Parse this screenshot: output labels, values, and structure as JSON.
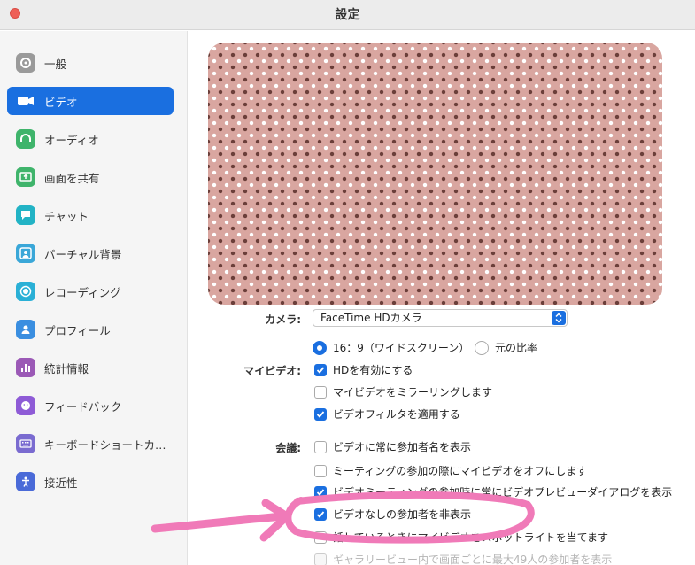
{
  "window": {
    "title": "設定"
  },
  "sidebar": {
    "items": [
      {
        "label": "一般",
        "icon": "gear-icon",
        "color": "#9a9a9a",
        "active": false
      },
      {
        "label": "ビデオ",
        "icon": "video-camera-icon",
        "color": "#1a6fe0",
        "active": true
      },
      {
        "label": "オーディオ",
        "icon": "headphones-icon",
        "color": "#3fb46b",
        "active": false
      },
      {
        "label": "画面を共有",
        "icon": "share-screen-icon",
        "color": "#3fb46b",
        "active": false
      },
      {
        "label": "チャット",
        "icon": "chat-bubble-icon",
        "color": "#22b3c5",
        "active": false
      },
      {
        "label": "バーチャル背景",
        "icon": "virtual-background-icon",
        "color": "#3aa7d8",
        "active": false
      },
      {
        "label": "レコーディング",
        "icon": "record-icon",
        "color": "#2ab0d6",
        "active": false
      },
      {
        "label": "プロフィール",
        "icon": "profile-icon",
        "color": "#3a8ee0",
        "active": false
      },
      {
        "label": "統計情報",
        "icon": "statistics-icon",
        "color": "#9b59b6",
        "active": false
      },
      {
        "label": "フィードバック",
        "icon": "feedback-icon",
        "color": "#8e5bd6",
        "active": false
      },
      {
        "label": "キーボードショートカ…",
        "icon": "keyboard-icon",
        "color": "#7a6bd0",
        "active": false
      },
      {
        "label": "接近性",
        "icon": "accessibility-icon",
        "color": "#4a6ad8",
        "active": false
      }
    ]
  },
  "video": {
    "camera_label": "カメラ:",
    "camera_value": "FaceTime HDカメラ",
    "my_video_label": "マイビデオ:",
    "aspect_options": [
      {
        "label": "16：9（ワイドスクリーン）",
        "selected": true
      },
      {
        "label": "元の比率",
        "selected": false
      }
    ],
    "my_video_options": [
      {
        "label": "HDを有効にする",
        "checked": true
      },
      {
        "label": "マイビデオをミラーリングします",
        "checked": false
      },
      {
        "label": "ビデオフィルタを適用する",
        "checked": true
      }
    ],
    "meeting_label": "会議:",
    "meeting_options": [
      {
        "label": "ビデオに常に参加者名を表示",
        "checked": false
      },
      {
        "label": "ミーティングの参加の際にマイビデオをオフにします",
        "checked": false
      },
      {
        "label": "ビデオミーティングの参加時に常にビデオプレビューダイアログを表示",
        "checked": true
      },
      {
        "label": "ビデオなしの参加者を非表示",
        "checked": true
      },
      {
        "label": "話しているときにマイビデオをスポットライトを当てます",
        "checked": false
      },
      {
        "label": "ギャラリービュー内で画面ごとに最大49人の参加者を表示",
        "checked": false,
        "disabled": true
      }
    ]
  },
  "annotation_color": "#f07ab8"
}
